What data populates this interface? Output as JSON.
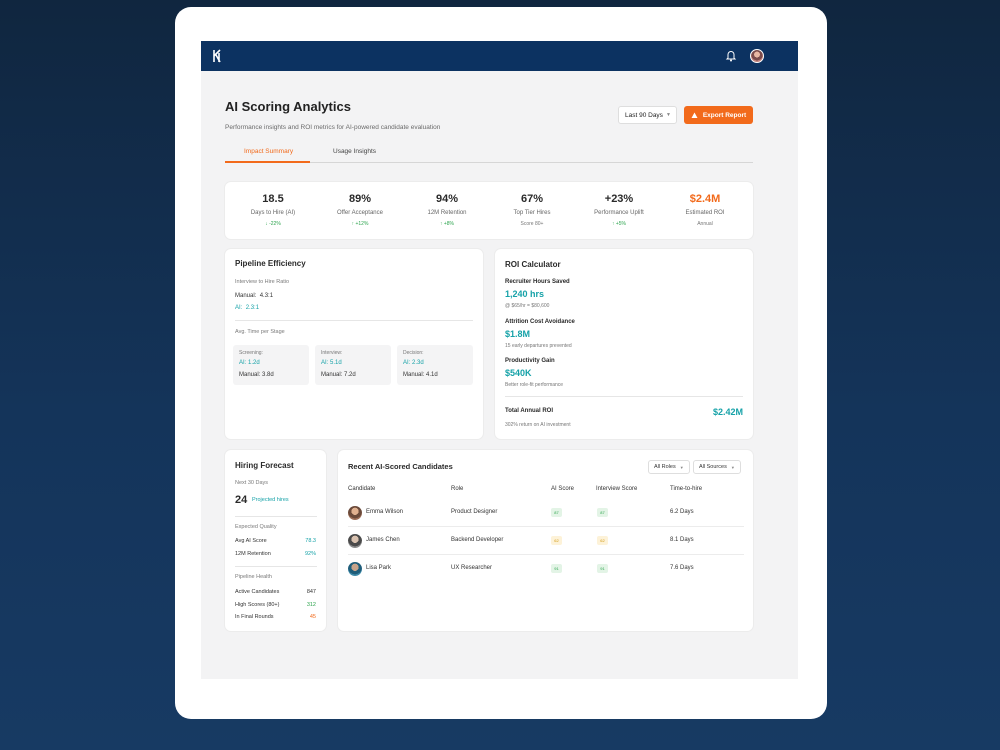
{
  "header": {
    "logo_icon": "logo-icon",
    "bell_icon": "bell-icon",
    "brand_color": "#0c3261"
  },
  "page": {
    "title": "AI Scoring Analytics",
    "subtitle": "Performance insights and ROI metrics for AI-powered candidate evaluation",
    "period_label": "Last 90 Days",
    "export_label": "Export Report",
    "accent_color": "#f26a1b"
  },
  "tabs": [
    {
      "label": "Impact Summary",
      "active": true
    },
    {
      "label": "Usage Insights",
      "active": false
    }
  ],
  "kpis": [
    {
      "value": "18.5",
      "label": "Days to Hire (AI)",
      "delta": "-22%",
      "direction": "down"
    },
    {
      "value": "89%",
      "label": "Offer Acceptance",
      "delta": "+12%",
      "direction": "up"
    },
    {
      "value": "94%",
      "label": "12M Retention",
      "delta": "+8%",
      "direction": "up"
    },
    {
      "value": "67%",
      "label": "Top Tier Hires",
      "delta": "Score 80+",
      "direction": "none"
    },
    {
      "value": "+23%",
      "label": "Performance Uplift",
      "delta": "+5%",
      "direction": "up"
    },
    {
      "value": "$2.4M",
      "label": "Estimated ROI",
      "delta": "Annual",
      "direction": "none"
    }
  ],
  "pipeline": {
    "title": "Pipeline Efficiency",
    "ratio_label": "Interview to Hire Ratio",
    "manual_label": "Manual:",
    "manual_value": "4.3:1",
    "ai_label": "AI:",
    "ai_value": "2.3:1",
    "stage_title": "Avg. Time per Stage",
    "stages": [
      {
        "name": "Screening:",
        "ai": "AI: 1.2d",
        "manual": "Manual: 3.8d"
      },
      {
        "name": "Interview:",
        "ai": "AI: 5.1d",
        "manual": "Manual: 7.2d"
      },
      {
        "name": "Decision:",
        "ai": "AI: 2.3d",
        "manual": "Manual: 4.1d"
      }
    ]
  },
  "roi": {
    "title": "ROI Calculator",
    "items": [
      {
        "label": "Recruiter Hours Saved",
        "value": "1,240 hrs",
        "note": "@ $65/hr = $80,600"
      },
      {
        "label": "Attrition Cost Avoidance",
        "value": "$1.8M",
        "note": "15 early departures prevented"
      },
      {
        "label": "Productivity Gain",
        "value": "$540K",
        "note": "Better role-fit performance"
      }
    ],
    "total_label": "Total Annual ROI",
    "total_value": "$2.42M",
    "total_note": "302% return on AI investment"
  },
  "forecast": {
    "title": "Hiring Forecast",
    "period": "Next 30 Days",
    "projected_value": "24",
    "projected_label": "Projected hires",
    "quality_title": "Expected Quality",
    "quality": [
      {
        "label": "Avg AI Score",
        "value": "78.3"
      },
      {
        "label": "12M Retention",
        "value": "92%"
      }
    ],
    "health_title": "Pipeline Health",
    "health": [
      {
        "label": "Active Candidates",
        "value": "847"
      },
      {
        "label": "High Scores (80+)",
        "value": "312"
      },
      {
        "label": "In Final Rounds",
        "value": "45"
      }
    ]
  },
  "candidates": {
    "title": "Recent AI-Scored Candidates",
    "filters": [
      "All Roles",
      "All Sources"
    ],
    "columns": [
      "Candidate",
      "Role",
      "AI Score",
      "Interview Score",
      "Time-to-hire"
    ],
    "rows": [
      {
        "name": "Emma Wilson",
        "role": "Product Designer",
        "ai_score": "87",
        "interview_score": "87",
        "time": "6.2 Days",
        "level": "good"
      },
      {
        "name": "James Chen",
        "role": "Backend Developer",
        "ai_score": "62",
        "interview_score": "62",
        "time": "8.1 Days",
        "level": "mid"
      },
      {
        "name": "Lisa Park",
        "role": "UX Researcher",
        "ai_score": "91",
        "interview_score": "91",
        "time": "7.6 Days",
        "level": "good"
      }
    ]
  }
}
